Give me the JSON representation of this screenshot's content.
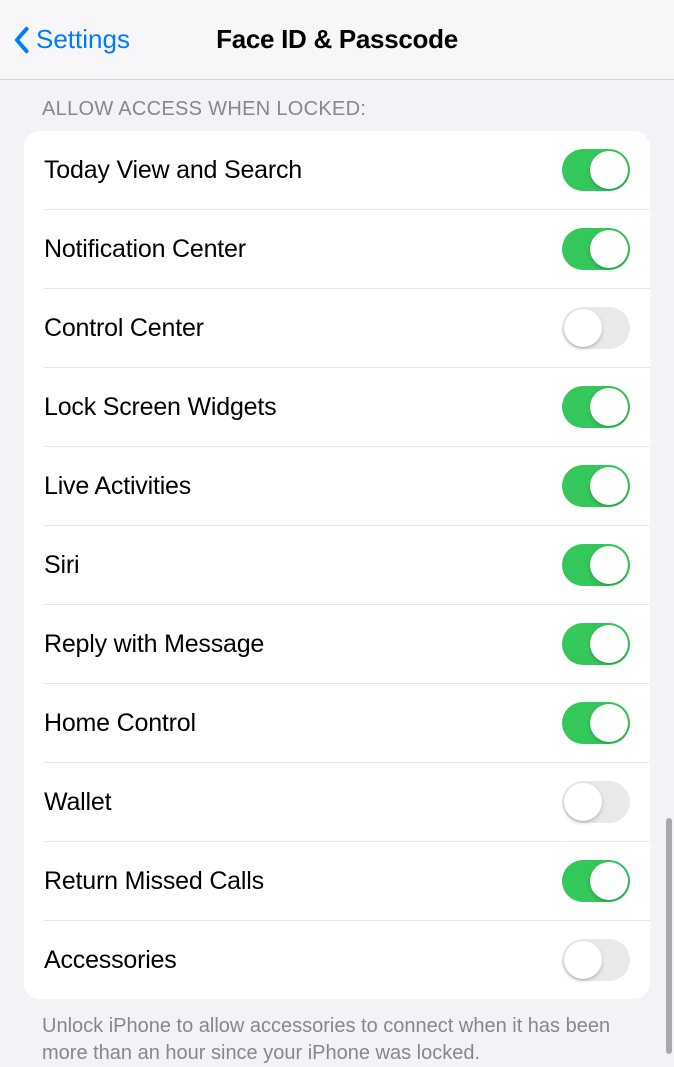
{
  "nav": {
    "back_label": "Settings",
    "title": "Face ID & Passcode"
  },
  "section": {
    "header": "ALLOW ACCESS WHEN LOCKED:",
    "footer": "Unlock iPhone to allow accessories to connect when it has been more than an hour since your iPhone was locked."
  },
  "rows": [
    {
      "label": "Today View and Search",
      "on": true
    },
    {
      "label": "Notification Center",
      "on": true
    },
    {
      "label": "Control Center",
      "on": false
    },
    {
      "label": "Lock Screen Widgets",
      "on": true
    },
    {
      "label": "Live Activities",
      "on": true
    },
    {
      "label": "Siri",
      "on": true
    },
    {
      "label": "Reply with Message",
      "on": true
    },
    {
      "label": "Home Control",
      "on": true
    },
    {
      "label": "Wallet",
      "on": false
    },
    {
      "label": "Return Missed Calls",
      "on": true
    },
    {
      "label": "Accessories",
      "on": false
    }
  ]
}
